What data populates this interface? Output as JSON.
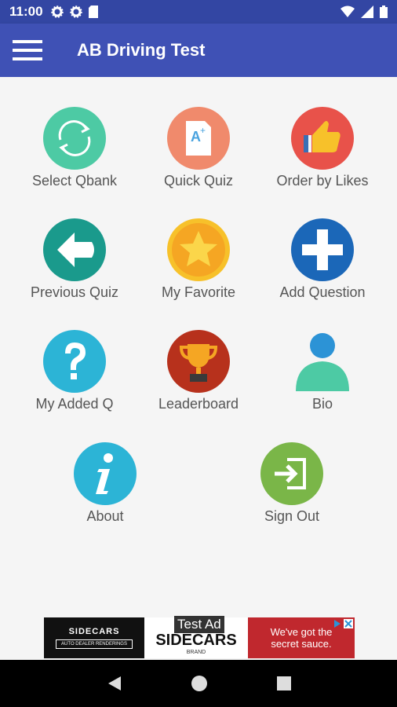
{
  "status_bar": {
    "time": "11:00",
    "icons_left": [
      "settings-icon",
      "settings-icon",
      "sd-card-icon"
    ],
    "icons_right": [
      "wifi-icon",
      "signal-icon",
      "battery-icon"
    ]
  },
  "app_bar": {
    "title": "AB Driving Test",
    "menu_icon": "menu-icon"
  },
  "menu": {
    "tiles": [
      {
        "label": "Select Qbank",
        "icon": "refresh-icon",
        "color": "#4dcaa4"
      },
      {
        "label": "Quick Quiz",
        "icon": "quiz-paper-icon",
        "color": "#f08a6c"
      },
      {
        "label": "Order by Likes",
        "icon": "thumbs-up-icon",
        "color": "#e8524a"
      },
      {
        "label": "Previous Quiz",
        "icon": "arrow-left-icon",
        "color": "#1a9a8c"
      },
      {
        "label": "My Favorite",
        "icon": "star-icon",
        "color": "#f7c12a"
      },
      {
        "label": "Add Question",
        "icon": "plus-icon",
        "color": "#1b67b8"
      },
      {
        "label": "My Added Q",
        "icon": "question-icon",
        "color": "#2cb4d6"
      },
      {
        "label": "Leaderboard",
        "icon": "trophy-icon",
        "color": "#b7311c"
      },
      {
        "label": "Bio",
        "icon": "person-icon",
        "color": "#4dcaa4"
      },
      {
        "label": "About",
        "icon": "info-icon",
        "color": "#2cb4d6"
      },
      {
        "label": "Sign Out",
        "icon": "sign-out-icon",
        "color": "#7ab648"
      }
    ]
  },
  "ad": {
    "badge": "Test Ad",
    "left_brand": "SIDECARS",
    "left_tagline": "AUTO DEALER RENDERINGS",
    "mid_brand": "SIDECARS",
    "mid_sub": "BRAND",
    "right_text": "We've got the secret sauce.",
    "ad_choices_icon": "ad-choices-icon",
    "close_icon": "close-icon"
  },
  "nav_bar": {
    "back": "back-icon",
    "home": "home-icon",
    "recents": "recents-icon"
  }
}
